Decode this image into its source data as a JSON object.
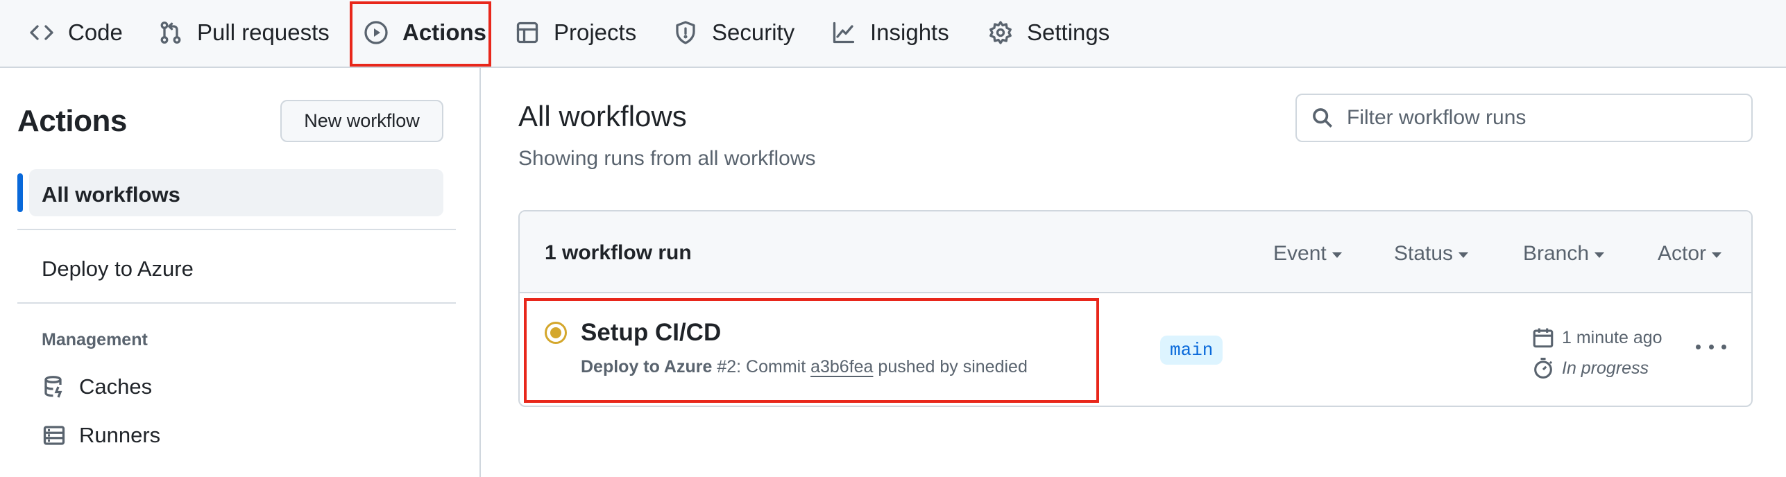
{
  "nav": {
    "tabs": [
      {
        "label": "Code",
        "icon": "code-icon"
      },
      {
        "label": "Pull requests",
        "icon": "pull-request-icon"
      },
      {
        "label": "Actions",
        "icon": "play-icon",
        "active": true
      },
      {
        "label": "Projects",
        "icon": "table-icon"
      },
      {
        "label": "Security",
        "icon": "shield-icon"
      },
      {
        "label": "Insights",
        "icon": "graph-icon"
      },
      {
        "label": "Settings",
        "icon": "gear-icon"
      }
    ]
  },
  "sidebar": {
    "title": "Actions",
    "new_workflow_label": "New workflow",
    "items": [
      {
        "label": "All workflows",
        "active": true
      },
      {
        "label": "Deploy to Azure"
      }
    ],
    "management_label": "Management",
    "management_items": [
      {
        "label": "Caches",
        "icon": "database-icon"
      },
      {
        "label": "Runners",
        "icon": "server-icon"
      }
    ]
  },
  "main": {
    "title": "All workflows",
    "subtitle": "Showing runs from all workflows",
    "filter_placeholder": "Filter workflow runs",
    "run_count": "1 workflow run",
    "filters": [
      "Event",
      "Status",
      "Branch",
      "Actor"
    ],
    "runs": [
      {
        "title": "Setup CI/CD",
        "workflow": "Deploy to Azure",
        "run_number": "#2",
        "meta_mid": ": Commit ",
        "sha": "a3b6fea",
        "meta_tail": " pushed by sinedied",
        "branch": "main",
        "time": "1 minute ago",
        "duration": "In progress",
        "status": "in-progress"
      }
    ]
  },
  "colors": {
    "accent": "#0969da",
    "in_progress": "#d4a72c",
    "highlight": "#e8271b"
  }
}
